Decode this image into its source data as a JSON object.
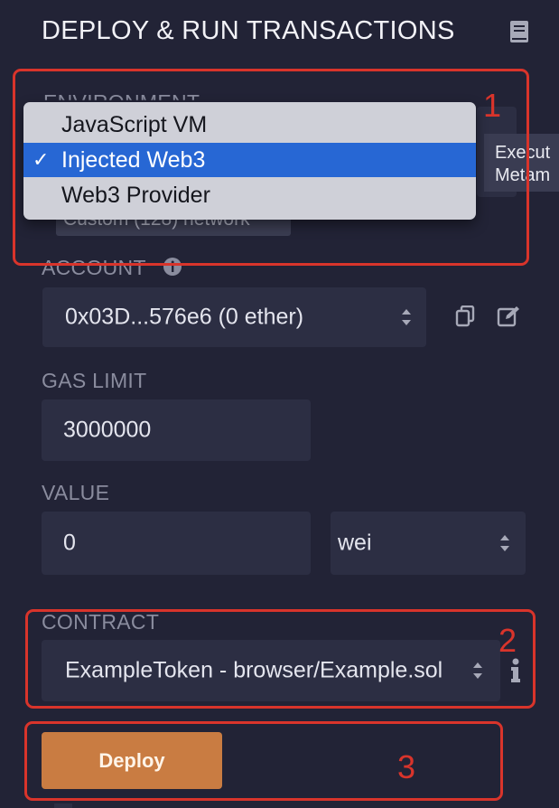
{
  "panel": {
    "title": "DEPLOY & RUN TRANSACTIONS",
    "icons": {
      "docs": "book-icon"
    }
  },
  "environment": {
    "label": "ENVIRONMENT",
    "options": [
      "JavaScript VM",
      "Injected Web3",
      "Web3 Provider"
    ],
    "selected": "Injected Web3",
    "check_mark": "✓",
    "network_badge": "Custom (128) network",
    "tooltip_lines": [
      "Execut",
      "Metam"
    ]
  },
  "account": {
    "label": "ACCOUNT",
    "value": "0x03D...576e6 (0 ether)",
    "icons": [
      "info-icon",
      "copy-icon",
      "edit-icon"
    ]
  },
  "gas_limit": {
    "label": "GAS LIMIT",
    "value": "3000000"
  },
  "value": {
    "label": "VALUE",
    "amount": "0",
    "unit": "wei"
  },
  "contract": {
    "label": "CONTRACT",
    "value": "ExampleToken - browser/Example.sol"
  },
  "actions": {
    "deploy_label": "Deploy"
  },
  "annotations": {
    "marker_1": "1",
    "marker_2": "2",
    "marker_3": "3",
    "color": "#d9342b"
  },
  "colors": {
    "background": "#222336",
    "field": "#2c2e43",
    "deploy": "#c97c42",
    "selected_option": "#2767d4"
  }
}
